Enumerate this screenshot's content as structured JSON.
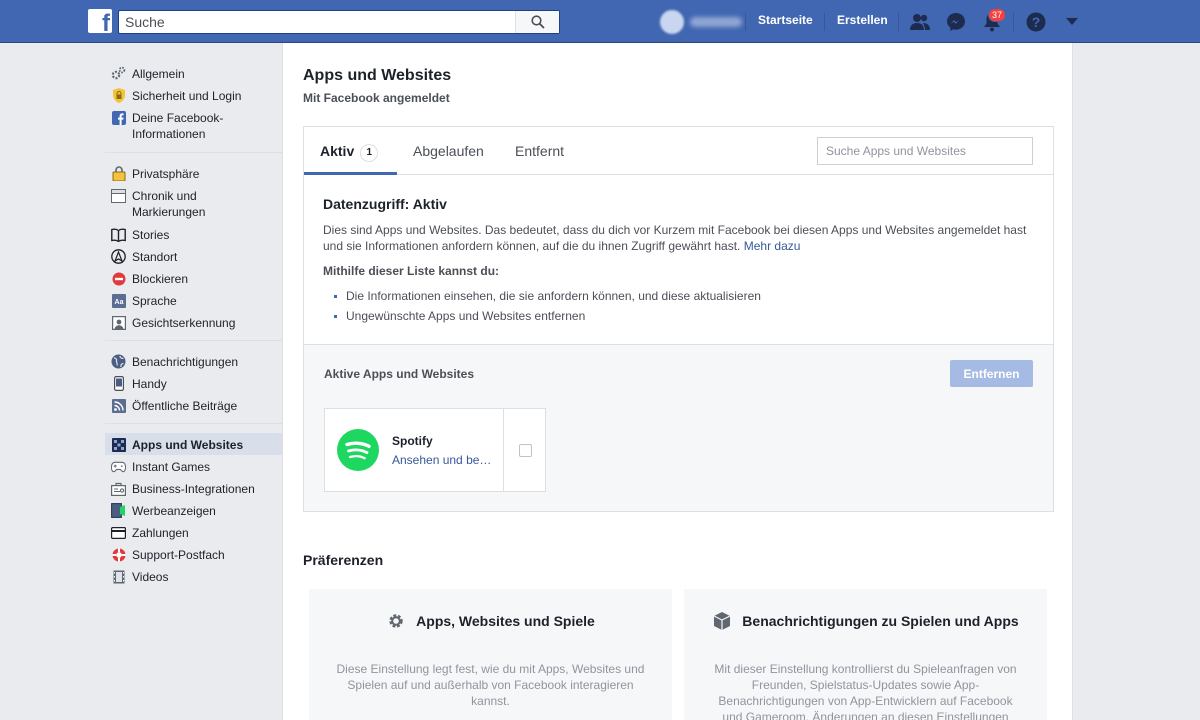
{
  "header": {
    "logo": "f",
    "search_placeholder": "Suche",
    "nav": {
      "home": "Startseite",
      "create": "Erstellen"
    },
    "notification_count": "37",
    "icons": [
      "friends-icon",
      "messenger-icon",
      "bell-icon",
      "help-icon",
      "dropdown-arrow-icon"
    ]
  },
  "sidebar": {
    "groups": [
      [
        {
          "label": "Allgemein",
          "icon": "gear-icon"
        },
        {
          "label": "Sicherheit und Login",
          "icon": "shield-icon"
        },
        {
          "label": "Deine Facebook-\nInformationen",
          "icon": "facebook-icon"
        }
      ],
      [
        {
          "label": "Privatsphäre",
          "icon": "lock-icon"
        },
        {
          "label": "Chronik und\nMarkierungen",
          "icon": "timeline-icon"
        },
        {
          "label": "Stories",
          "icon": "book-icon"
        },
        {
          "label": "Standort",
          "icon": "location-icon"
        },
        {
          "label": "Blockieren",
          "icon": "block-icon"
        },
        {
          "label": "Sprache",
          "icon": "language-icon"
        },
        {
          "label": "Gesichtserkennung",
          "icon": "face-icon"
        }
      ],
      [
        {
          "label": "Benachrichtigungen",
          "icon": "globe-icon"
        },
        {
          "label": "Handy",
          "icon": "phone-icon"
        },
        {
          "label": "Öffentliche Beiträge",
          "icon": "rss-icon"
        }
      ],
      [
        {
          "label": "Apps und Websites",
          "icon": "apps-icon",
          "active": true
        },
        {
          "label": "Instant Games",
          "icon": "gamepad-icon"
        },
        {
          "label": "Business-Integrationen",
          "icon": "business-icon"
        },
        {
          "label": "Werbeanzeigen",
          "icon": "ads-icon"
        },
        {
          "label": "Zahlungen",
          "icon": "card-icon"
        },
        {
          "label": "Support-Postfach",
          "icon": "lifebuoy-icon"
        },
        {
          "label": "Videos",
          "icon": "film-icon"
        }
      ]
    ]
  },
  "main": {
    "title": "Apps und Websites",
    "subtitle": "Mit Facebook angemeldet",
    "tabs": {
      "active": "Aktiv",
      "active_count": "1",
      "expired": "Abgelaufen",
      "removed": "Entfernt"
    },
    "search_placeholder": "Suche Apps und Websites",
    "info": {
      "heading": "Datenzugriff: Aktiv",
      "text": "Dies sind Apps und Websites. Das bedeutet, dass du dich vor Kurzem mit Facebook bei diesen Apps und Websites angemeldet hast und sie Informationen anfordern können, auf die du ihnen Zugriff gewährt hast.",
      "link": "Mehr dazu",
      "list_title": "Mithilfe dieser Liste kannst du:",
      "list": [
        "Die Informationen einsehen, die sie anfordern können, und diese aktualisieren",
        "Ungewünschte Apps und Websites entfernen"
      ]
    },
    "active_apps": {
      "title": "Aktive Apps und Websites",
      "remove_button": "Entfernen",
      "app": {
        "name": "Spotify",
        "link": "Ansehen und be…",
        "color": "#1ed760"
      }
    },
    "preferences": {
      "title": "Präferenzen",
      "cards": [
        {
          "title": "Apps, Websites und Spiele",
          "icon": "gear-icon",
          "desc": "Diese Einstellung legt fest, wie du mit Apps, Websites und Spielen auf und außerhalb von Facebook interagieren kannst."
        },
        {
          "title": "Benachrichtigungen zu Spielen und Apps",
          "icon": "cube-icon",
          "desc": "Mit dieser Einstellung kontrollierst du Spieleanfragen von Freunden, Spielstatus-Updates sowie App-Benachrichtigungen von App-Entwicklern auf Facebook und Gameroom. Änderungen an diesen Einstellungen"
        }
      ]
    }
  },
  "colors": {
    "brand": "#4267b2",
    "link": "#365899",
    "badge": "#fa3e3e",
    "spotify": "#1ed760"
  }
}
